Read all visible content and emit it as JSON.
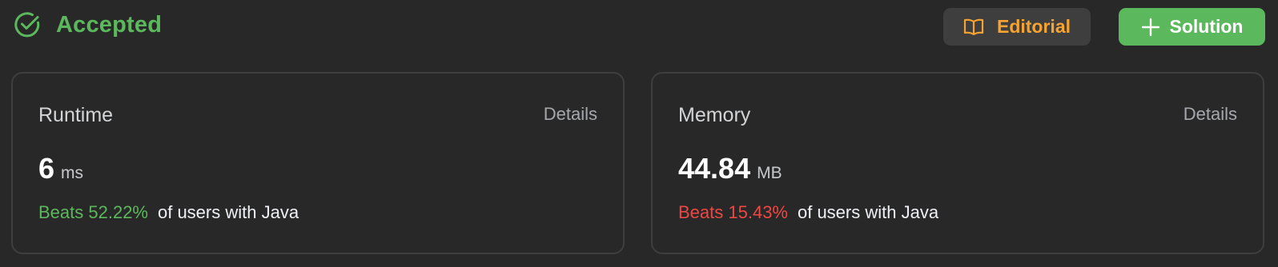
{
  "status": {
    "label": "Accepted",
    "icon": "check-circle-icon",
    "color": "#5cb85c"
  },
  "actions": {
    "editorial": {
      "label": "Editorial",
      "icon": "book-open-icon",
      "color": "#f5a433"
    },
    "solution": {
      "label": "Solution",
      "icon": "plus-icon",
      "color": "#5cb85c"
    }
  },
  "runtime": {
    "title": "Runtime",
    "details_label": "Details",
    "value": "6",
    "unit": "ms",
    "beats_text": "Beats 52.22%",
    "beats_percent": 52.22,
    "beats_color": "#5cb85c",
    "suffix": "of users with Java"
  },
  "memory": {
    "title": "Memory",
    "details_label": "Details",
    "value": "44.84",
    "unit": "MB",
    "beats_text": "Beats 15.43%",
    "beats_percent": 15.43,
    "beats_color": "#ef4743",
    "suffix": "of users with Java"
  }
}
